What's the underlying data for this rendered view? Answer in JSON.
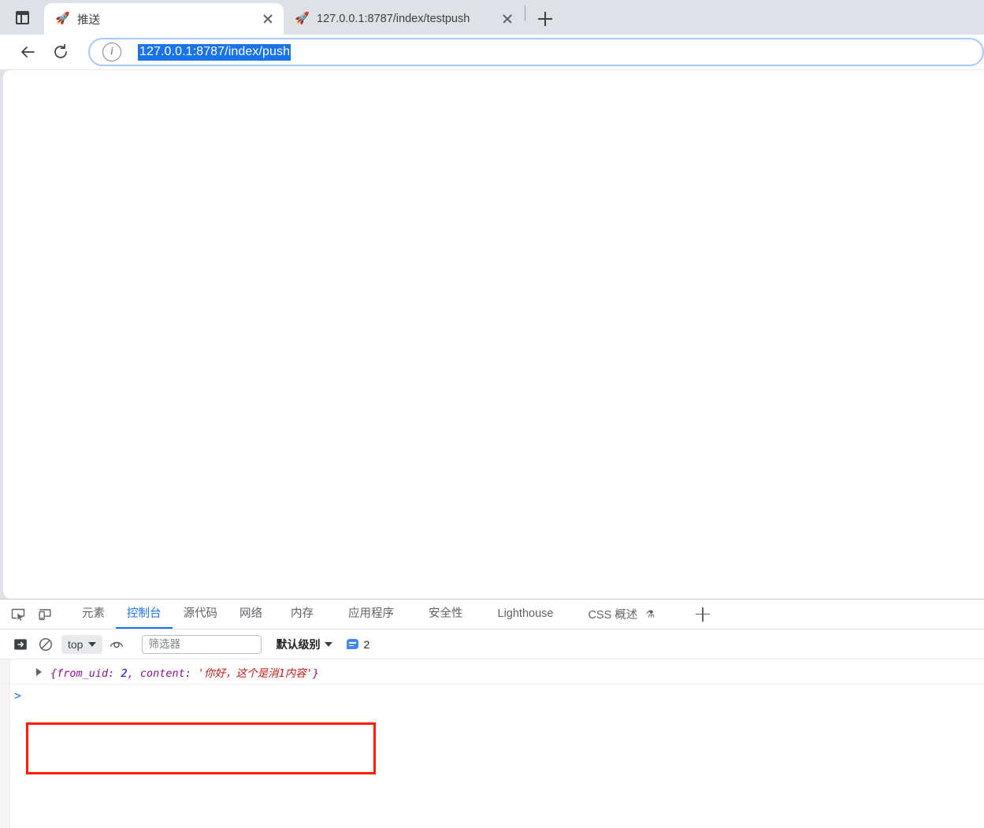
{
  "browser": {
    "tab_search_icon": "tab-search-icon",
    "tabs": [
      {
        "title": "推送",
        "favicon": "🚀",
        "active": true,
        "close_icon": "close-icon"
      },
      {
        "title": "127.0.0.1:8787/index/testpush",
        "favicon": "🚀",
        "active": false,
        "close_icon": "close-icon"
      }
    ],
    "new_tab_label": "+",
    "toolbar": {
      "back_icon": "back-arrow-icon",
      "reload_icon": "reload-icon",
      "site_info_icon": "info-circle-icon",
      "url": "127.0.0.1:8787/index/push",
      "url_selected": true,
      "selection_color": "#1a73e8"
    }
  },
  "page": {
    "content": ""
  },
  "devtools": {
    "inspect_icon": "inspect-element-icon",
    "device_toolbar_icon": "device-toolbar-icon",
    "tabs": [
      {
        "label": "元素",
        "active": false
      },
      {
        "label": "控制台",
        "active": true
      },
      {
        "label": "源代码",
        "active": false
      },
      {
        "label": "网络",
        "active": false
      },
      {
        "label": "内存",
        "active": false
      },
      {
        "label": "应用程序",
        "active": false
      },
      {
        "label": "安全性",
        "active": false
      },
      {
        "label": "Lighthouse",
        "active": false
      },
      {
        "label": "CSS 概述",
        "active": false,
        "flask": "⚗"
      }
    ],
    "add_tab_label": "+",
    "accent_color": "#1a73e8",
    "console_toolbar": {
      "sidebar_icon": "console-sidebar-icon",
      "clear_icon": "clear-console-icon",
      "context": "top",
      "context_caret": "chevron-down-icon",
      "eye_icon": "live-expression-eye-icon",
      "filter_placeholder": "筛选器",
      "filter_value": "",
      "level_label": "默认级别",
      "level_caret": "chevron-down-icon",
      "message_badge_icon": "message-bubble-icon",
      "message_count": "2"
    },
    "console_log": {
      "expand_icon": "expand-triangle-icon",
      "open_brace": "{",
      "key1": "from_uid:",
      "value1": "2",
      "comma": ", ",
      "key2": "content:",
      "value2": "'你好，这个是消1内容'",
      "close_brace": "}",
      "full_text": "{from_uid: 2, content: '你好，这个是消1内容'}"
    },
    "prompt_caret": ">",
    "annotation": {
      "name": "red-highlight-rectangle",
      "color": "#ff1a00"
    }
  }
}
